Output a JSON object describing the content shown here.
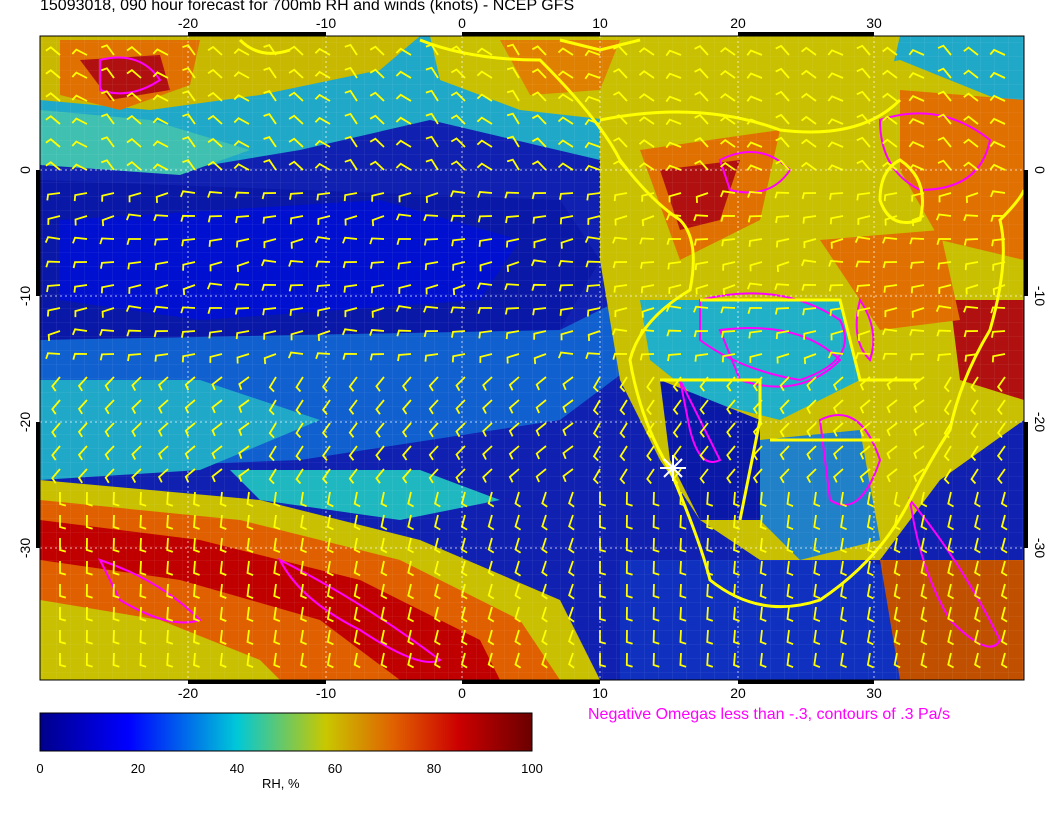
{
  "title": "15093018, 090 hour forecast for 700mb RH and winds (knots) - NCEP GFS",
  "map": {
    "lon_range": [
      -30,
      40
    ],
    "lat_range": [
      -40,
      10
    ],
    "lon_ticks": [
      "-20",
      "-10",
      "0",
      "10",
      "20",
      "30"
    ],
    "lat_ticks": [
      "0",
      "-10",
      "-20",
      "-30"
    ],
    "overlay_color": "#ffff00",
    "omega_color": "#ff00ff",
    "marker_color": "#ffffff"
  },
  "omega_note": "Negative Omegas less than -.3, contours of .3 Pa/s",
  "colorbar": {
    "label": "RH, %",
    "ticks": [
      "0",
      "20",
      "40",
      "60",
      "80",
      "100"
    ],
    "colors": [
      "#00008b",
      "#0000ff",
      "#00bcd4",
      "#c8c800",
      "#e06000",
      "#cc0000",
      "#6b0000"
    ]
  }
}
